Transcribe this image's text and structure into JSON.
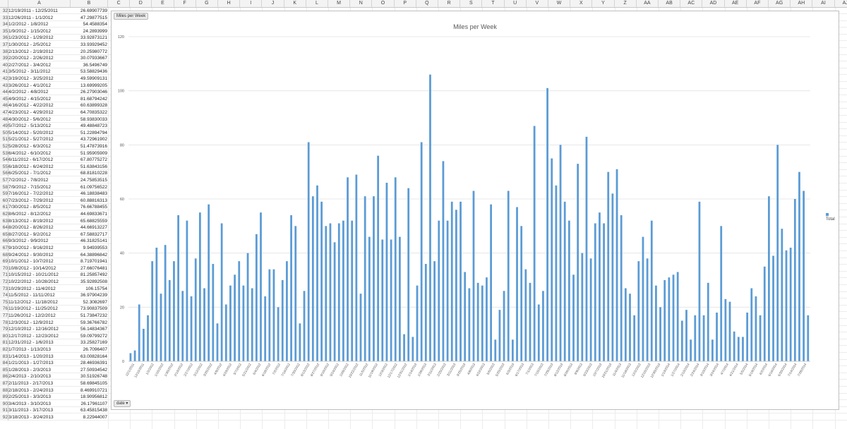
{
  "columns": [
    "A",
    "B",
    "C",
    "D",
    "E",
    "F",
    "G",
    "H",
    "I",
    "J",
    "K",
    "L",
    "M",
    "N",
    "O",
    "P",
    "Q",
    "R",
    "S",
    "T",
    "U",
    "V",
    "W",
    "X",
    "Y",
    "Z",
    "AA",
    "AB",
    "AC",
    "AD",
    "AE",
    "AF",
    "AG",
    "AH",
    "AI",
    "AJ"
  ],
  "rows": [
    {
      "n": "32",
      "a": "12/19/2011 - 12/25/2011",
      "b": "26.69907739"
    },
    {
      "n": "33",
      "a": "12/26/2011 - 1/1/2012",
      "b": "47.29877515"
    },
    {
      "n": "34",
      "a": "1/2/2012 - 1/8/2012",
      "b": "54.4588354"
    },
    {
      "n": "35",
      "a": "1/9/2012 - 1/15/2012",
      "b": "24.2893999"
    },
    {
      "n": "36",
      "a": "1/23/2012 - 1/29/2012",
      "b": "33.92873121"
    },
    {
      "n": "37",
      "a": "1/30/2012 - 2/5/2012",
      "b": "33.93929452"
    },
    {
      "n": "38",
      "a": "2/13/2012 - 2/19/2012",
      "b": "20.25980772"
    },
    {
      "n": "39",
      "a": "2/20/2012 - 2/26/2012",
      "b": "30.07933667"
    },
    {
      "n": "40",
      "a": "2/27/2012 - 3/4/2012",
      "b": "36.5496749"
    },
    {
      "n": "41",
      "a": "3/5/2012 - 3/11/2012",
      "b": "53.58829436"
    },
    {
      "n": "42",
      "a": "3/19/2012 - 3/25/2012",
      "b": "49.59909131"
    },
    {
      "n": "43",
      "a": "3/26/2012 - 4/1/2012",
      "b": "13.69999205"
    },
    {
      "n": "44",
      "a": "4/2/2012 - 4/8/2012",
      "b": "26.27903046"
    },
    {
      "n": "45",
      "a": "4/9/2012 - 4/15/2012",
      "b": "81.68794242"
    },
    {
      "n": "46",
      "a": "4/16/2012 - 4/22/2012",
      "b": "60.63899328"
    },
    {
      "n": "47",
      "a": "4/23/2012 - 4/29/2012",
      "b": "64.70835322"
    },
    {
      "n": "48",
      "a": "4/30/2012 - 5/6/2012",
      "b": "58.93830033"
    },
    {
      "n": "49",
      "a": "5/7/2012 - 5/13/2012",
      "b": "49.48848723"
    },
    {
      "n": "50",
      "a": "5/14/2012 - 5/20/2012",
      "b": "51.22894794"
    },
    {
      "n": "51",
      "a": "5/21/2012 - 5/27/2012",
      "b": "43.72961902"
    },
    {
      "n": "52",
      "a": "5/28/2012 - 6/3/2012",
      "b": "51.47873916"
    },
    {
      "n": "53",
      "a": "6/4/2012 - 6/10/2012",
      "b": "51.95905909"
    },
    {
      "n": "54",
      "a": "6/11/2012 - 6/17/2012",
      "b": "67.80775272"
    },
    {
      "n": "55",
      "a": "6/18/2012 - 6/24/2012",
      "b": "51.63843156"
    },
    {
      "n": "56",
      "a": "6/25/2012 - 7/1/2012",
      "b": "68.81810228"
    },
    {
      "n": "57",
      "a": "7/2/2012 - 7/8/2012",
      "b": "24.75853515"
    },
    {
      "n": "58",
      "a": "7/9/2012 - 7/15/2012",
      "b": "61.09756522"
    },
    {
      "n": "59",
      "a": "7/16/2012 - 7/22/2012",
      "b": "46.18838483"
    },
    {
      "n": "60",
      "a": "7/23/2012 - 7/29/2012",
      "b": "60.88816313"
    },
    {
      "n": "61",
      "a": "7/30/2012 - 8/5/2012",
      "b": "76.66788455"
    },
    {
      "n": "62",
      "a": "8/6/2012 - 8/12/2012",
      "b": "44.69833671"
    },
    {
      "n": "63",
      "a": "8/13/2012 - 8/19/2012",
      "b": "65.68825559"
    },
    {
      "n": "64",
      "a": "8/20/2012 - 8/26/2012",
      "b": "44.66913227"
    },
    {
      "n": "65",
      "a": "8/27/2012 - 9/2/2012",
      "b": "67.58832717"
    },
    {
      "n": "66",
      "a": "9/3/2012 - 9/9/2012",
      "b": "46.31825141"
    },
    {
      "n": "67",
      "a": "9/10/2012 - 9/16/2012",
      "b": "9.94939553"
    },
    {
      "n": "68",
      "a": "9/24/2012 - 9/30/2012",
      "b": "64.38896842"
    },
    {
      "n": "69",
      "a": "10/1/2012 - 10/7/2012",
      "b": "8.719701941"
    },
    {
      "n": "70",
      "a": "10/8/2012 - 10/14/2012",
      "b": "27.66076481"
    },
    {
      "n": "71",
      "a": "10/15/2012 - 10/21/2012",
      "b": "81.25857492"
    },
    {
      "n": "72",
      "a": "10/22/2012 - 10/28/2012",
      "b": "35.92892508"
    },
    {
      "n": "73",
      "a": "10/29/2012 - 11/4/2012",
      "b": "106.15754"
    },
    {
      "n": "74",
      "a": "11/5/2012 - 11/11/2012",
      "b": "36.97904239"
    },
    {
      "n": "75",
      "a": "11/12/2012 - 11/18/2012",
      "b": "52.3082697"
    },
    {
      "n": "76",
      "a": "11/19/2012 - 11/25/2012",
      "b": "73.90837509"
    },
    {
      "n": "77",
      "a": "11/26/2012 - 12/2/2012",
      "b": "51.73847232"
    },
    {
      "n": "78",
      "a": "12/3/2012 - 12/9/2012",
      "b": "59.36766782"
    },
    {
      "n": "79",
      "a": "12/10/2012 - 12/16/2012",
      "b": "56.14834367"
    },
    {
      "n": "80",
      "a": "12/17/2012 - 12/23/2012",
      "b": "59.09799272"
    },
    {
      "n": "81",
      "a": "12/31/2012 - 1/6/2013",
      "b": "33.25827169"
    },
    {
      "n": "82",
      "a": "1/7/2013 - 1/13/2013",
      "b": "26.7096407"
    },
    {
      "n": "83",
      "a": "1/14/2013 - 1/20/2013",
      "b": "63.00828164"
    },
    {
      "n": "84",
      "a": "1/21/2013 - 1/27/2013",
      "b": "28.46936391"
    },
    {
      "n": "85",
      "a": "1/28/2013 - 2/3/2013",
      "b": "27.50934542"
    },
    {
      "n": "86",
      "a": "2/4/2013 - 2/10/2013",
      "b": "30.51926748"
    },
    {
      "n": "87",
      "a": "2/11/2013 - 2/17/2013",
      "b": "58.69845105"
    },
    {
      "n": "88",
      "a": "2/18/2013 - 2/24/2013",
      "b": "8.469910721"
    },
    {
      "n": "89",
      "a": "2/25/2013 - 3/3/2013",
      "b": "18.90956812"
    },
    {
      "n": "90",
      "a": "3/4/2013 - 3/10/2013",
      "b": "26.17961107"
    },
    {
      "n": "91",
      "a": "3/11/2013 - 3/17/2013",
      "b": "63.45815438"
    },
    {
      "n": "92",
      "a": "3/18/2013 - 3/24/2013",
      "b": "8.22944007"
    }
  ],
  "chart": {
    "field_button_top": "Miles per Week",
    "field_button_axis": "date",
    "dropdown_glyph": "▾",
    "legend_label": "Total",
    "bar_color": "#5b9bd5"
  },
  "chart_data": {
    "type": "bar",
    "title": "Miles per Week",
    "xlabel": "",
    "ylabel": "",
    "ylim": [
      0,
      120
    ],
    "yticks": [
      0,
      20,
      40,
      60,
      80,
      100,
      120
    ],
    "grid": true,
    "legend": "right",
    "series": [
      {
        "name": "Total",
        "values": [
          3,
          4,
          21,
          12,
          17,
          37,
          42,
          25,
          43,
          30,
          37,
          54,
          26,
          52,
          24,
          38,
          55,
          27,
          58,
          36,
          14,
          51,
          21,
          28,
          32,
          37,
          28,
          40,
          27,
          47,
          55,
          24,
          34,
          34,
          20,
          30,
          37,
          54,
          50,
          14,
          26,
          81,
          61,
          65,
          59,
          50,
          51,
          44,
          51,
          52,
          68,
          52,
          69,
          25,
          61,
          46,
          61,
          76,
          45,
          66,
          45,
          68,
          46,
          10,
          64,
          9,
          28,
          81,
          36,
          106,
          37,
          52,
          74,
          52,
          59,
          56,
          59,
          33,
          27,
          63,
          29,
          28,
          31,
          58,
          8,
          19,
          26,
          63,
          8,
          57,
          50,
          34,
          29,
          87,
          21,
          26,
          101,
          75,
          65,
          80,
          59,
          52,
          32,
          73,
          40,
          83,
          38,
          51,
          55,
          51,
          70,
          62,
          71,
          54,
          27,
          25,
          17,
          37,
          46,
          38,
          52,
          28,
          20,
          30,
          31,
          32,
          33,
          15,
          19,
          8,
          17,
          59,
          17,
          29,
          8,
          18,
          50,
          23,
          22,
          11,
          9,
          9,
          18,
          27,
          24,
          17,
          35,
          61,
          39,
          80,
          49,
          41,
          42,
          60,
          70,
          63,
          17
        ]
      }
    ],
    "categories": [
      "12/1/2011",
      "12/15/2011",
      "1/2/2012",
      "1/16/2012",
      "1/30/2012",
      "2/13/2012",
      "2/27/2012",
      "3/12/2012",
      "3/26/2012",
      "4/9/2012",
      "4/23/2012",
      "5/7/2012",
      "5/21/2012",
      "6/4/2012",
      "6/18/2012",
      "7/2/2012",
      "7/16/2012",
      "7/30/2012",
      "8/13/2012",
      "8/27/2012",
      "9/10/2012",
      "9/24/2012",
      "10/8/2012",
      "10/22/2012",
      "11/5/2012",
      "11/19/2012",
      "12/3/2012",
      "12/17/2012",
      "12/31/2012",
      "1/14/2013",
      "1/28/2013",
      "2/11/2013",
      "2/25/2013",
      "3/11/2013",
      "3/25/2013",
      "4/8/2013",
      "4/22/2013",
      "5/6/2013",
      "5/20/2013",
      "6/3/2013",
      "6/17/2013",
      "7/1/2013",
      "7/15/2013",
      "7/29/2013",
      "8/12/2013",
      "8/26/2013",
      "9/9/2013",
      "9/23/2013",
      "10/7/2013",
      "10/21/2013",
      "11/4/2013",
      "11/18/2013",
      "12/2/2013",
      "12/16/2013",
      "12/30/2013",
      "1/13/2014",
      "1/27/2014",
      "2/10/2014",
      "2/24/2014",
      "3/10/2014",
      "3/24/2014",
      "4/7/2014",
      "4/21/2014",
      "5/5/2014",
      "5/19/2014",
      "6/2/2014",
      "6/16/2014",
      "6/30/2014",
      "7/14/2014",
      "7/28/2014"
    ]
  }
}
